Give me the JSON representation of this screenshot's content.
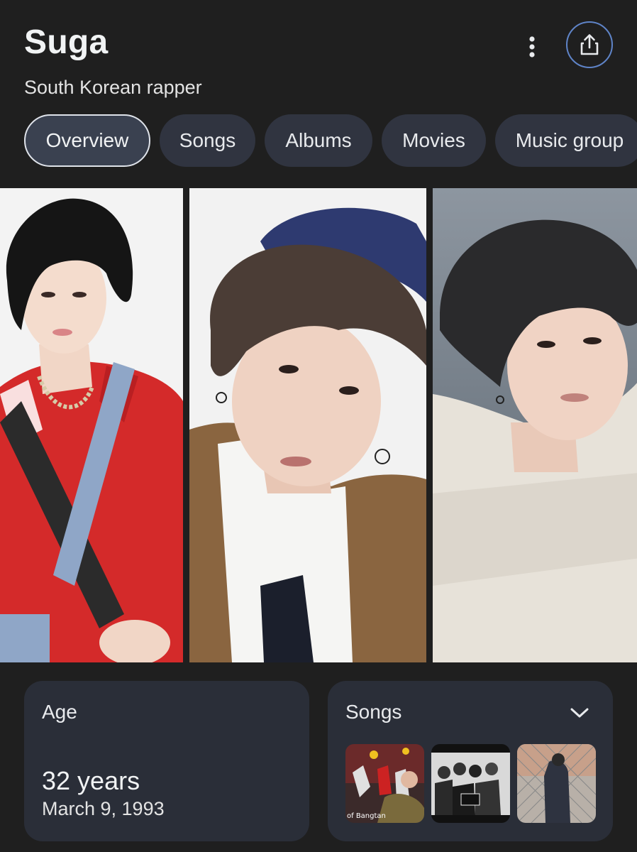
{
  "header": {
    "title": "Suga",
    "subtitle": "South Korean rapper",
    "more_icon": "more-vert-icon",
    "share_icon": "share-icon"
  },
  "tabs": [
    {
      "label": "Overview",
      "active": true
    },
    {
      "label": "Songs",
      "active": false
    },
    {
      "label": "Albums",
      "active": false
    },
    {
      "label": "Movies",
      "active": false
    },
    {
      "label": "Music group",
      "active": false
    }
  ],
  "images": [
    {
      "description": "photo-red-jacket"
    },
    {
      "description": "photo-navy-cap-brown-blazer"
    },
    {
      "description": "photo-white-knit-sweater"
    }
  ],
  "age_card": {
    "label": "Age",
    "value": "32 years",
    "date": "March 9, 1993"
  },
  "songs_card": {
    "label": "Songs",
    "expand_icon": "chevron-down-icon",
    "thumb_caption": "of Bangtan"
  },
  "colors": {
    "background": "#1f1f1f",
    "chip": "#303440",
    "card": "#2a2e38",
    "share_ring": "#5f84c8"
  }
}
